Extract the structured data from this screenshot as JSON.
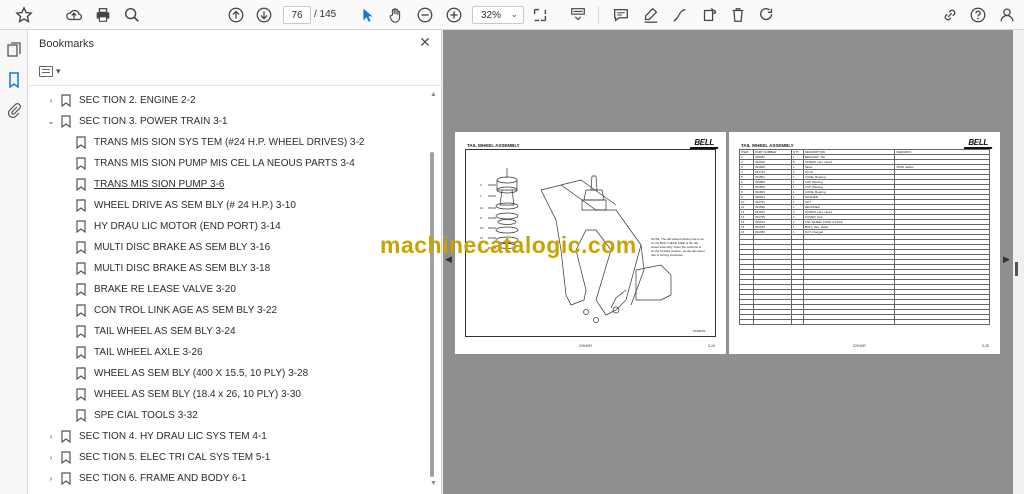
{
  "toolbar": {
    "icons": [
      "star-icon",
      "upload-icon",
      "print-icon",
      "search-icon",
      "page-up-icon",
      "page-down-icon",
      "cursor-icon",
      "hand-icon",
      "zoom-out-icon",
      "zoom-in-icon",
      "fit-page-icon",
      "scroll-mode-icon",
      "comment-icon",
      "highlight-icon",
      "sign-icon",
      "rotate-icon",
      "delete-icon",
      "redo-icon",
      "share-link-icon",
      "help-icon"
    ],
    "page_current": "76",
    "page_total": "/ 145",
    "zoom": "32%"
  },
  "panel": {
    "title": "Bookmarks",
    "items": [
      {
        "label": "SEC TION 2. ENGINE 2-2",
        "level": "top",
        "toggle": "›"
      },
      {
        "label": "SEC TION 3. POWER TRAIN 3-1",
        "level": "top",
        "toggle": "⌄"
      },
      {
        "label": "TRANS MIS SION SYS TEM (#24 H.P. WHEEL DRIVES) 3-2",
        "level": "child"
      },
      {
        "label": "TRANS MIS SION PUMP MIS CEL LA NEOUS PARTS 3-4",
        "level": "child"
      },
      {
        "label": "TRANS MIS SION PUMP  3-6",
        "level": "child",
        "selected": true
      },
      {
        "label": "WHEEL DRIVE AS SEM BLY (# 24 H.P.) 3-10",
        "level": "child"
      },
      {
        "label": "HY DRAU LIC MOTOR (END PORT) 3-14",
        "level": "child"
      },
      {
        "label": "MULTI DISC BRAKE AS SEM BLY  3-16",
        "level": "child"
      },
      {
        "label": "MULTI DISC BRAKE AS SEM BLY  3-18",
        "level": "child"
      },
      {
        "label": "BRAKE RE LEASE VALVE 3-20",
        "level": "child"
      },
      {
        "label": "CON TROL LINK AGE AS SEM BLY 3-22",
        "level": "child"
      },
      {
        "label": "TAIL WHEEL AS SEM BLY 3-24",
        "level": "child"
      },
      {
        "label": "TAIL WHEEL AXLE  3-26",
        "level": "child"
      },
      {
        "label": "WHEEL AS SEM BLY (400 X 15.5, 10 PLY) 3-28",
        "level": "child"
      },
      {
        "label": "WHEEL AS SEM BLY (18.4 x 26, 10 PLY) 3-30",
        "level": "child"
      },
      {
        "label": "SPE CIAL TOOLS 3-32",
        "level": "child"
      },
      {
        "label": "SEC TION 4. HY DRAU LIC SYS TEM 4-1",
        "level": "top",
        "toggle": "›"
      },
      {
        "label": "SEC TION 5. ELEC TRI CAL SYS TEM 5-1",
        "level": "top",
        "toggle": "›"
      },
      {
        "label": "SEC TION 6. FRAME AND BODY 6-1",
        "level": "top",
        "toggle": "›"
      }
    ]
  },
  "document": {
    "left_page": {
      "title": "TAIL WHEEL ASSEMBLY",
      "logo": "BELL",
      "note": "NOTE: The tail wheel bushing has to be on the BOLT HEAD SIDE of the tail wheel assembly, when the machine is on the forward position, as the tail wheel fork is turning clockwise.",
      "figure_id": "P10818S",
      "footer_left": "22H40R",
      "footer_right": "3-24"
    },
    "right_page": {
      "title": "TAIL WHEEL ASSEMBLY",
      "logo": "BELL",
      "headers": [
        "ITEM",
        "PART NUMBER",
        "QTY",
        "DESCRIPTION",
        "REMARKS"
      ],
      "rows": [
        [
          "1",
          "395387",
          "1",
          "BRACKET, Tail",
          ""
        ],
        [
          "2",
          "391610",
          "8",
          "SCREW, Hex. Head",
          ""
        ],
        [
          "3",
          "391900",
          "1",
          "SEAL",
          "25/36 cables"
        ],
        [
          "4",
          "391781",
          "1",
          "PLUG",
          ""
        ],
        [
          "5",
          "391801",
          "1",
          "CONE, Bearing",
          ""
        ],
        [
          "6",
          "391800",
          "1",
          "CUP, Bearing",
          ""
        ],
        [
          "7",
          "391802",
          "1",
          "CUP, Bearing",
          ""
        ],
        [
          "8",
          "391803",
          "1",
          "CONE, Bearing",
          ""
        ],
        [
          "9",
          "396501",
          "1",
          "WASHER",
          ""
        ],
        [
          "10",
          "391751",
          "1",
          "NUT",
          ""
        ],
        [
          "11",
          "391890",
          "1",
          "RETAINER",
          ""
        ],
        [
          "12",
          "391612",
          "4",
          "SCREW, Hex. Head",
          ""
        ],
        [
          "13",
          "391700",
          "1",
          "COVER, Hub",
          ""
        ],
        [
          "14",
          "391614",
          "2",
          "TAIL WHEEL FORK & AXLE",
          ""
        ],
        [
          "15",
          "391615",
          "1",
          "BOLT, Hex. Head",
          ""
        ],
        [
          "16",
          "391350",
          "1",
          "NUT, Flanged",
          ""
        ]
      ],
      "empty_rows": 18,
      "footer_left": "22H40R",
      "footer_right": "3-25"
    },
    "watermark": "machinecatalogic.com"
  },
  "colors": {
    "accent": "#1473e6",
    "doc_background": "#8f8f8f",
    "watermark": "#c9a400"
  }
}
